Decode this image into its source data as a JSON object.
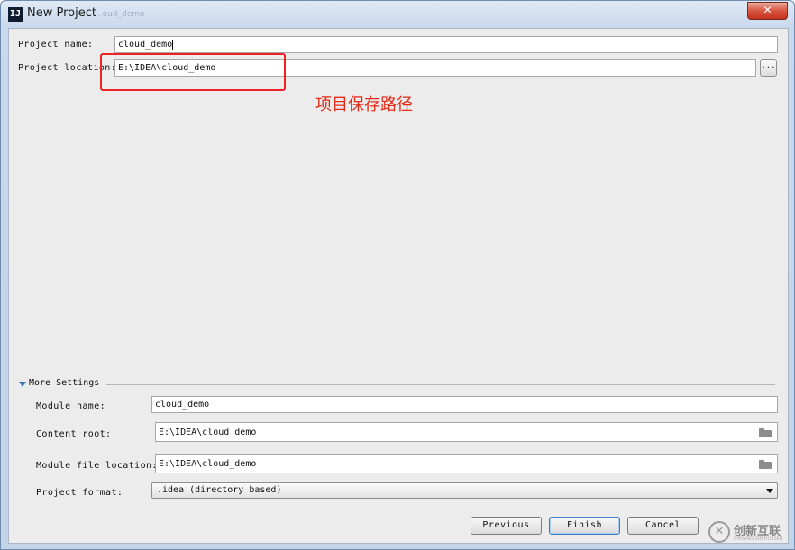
{
  "window": {
    "title": "New Project",
    "ghost_text": "...oud_demo",
    "app_icon_text": "IJ",
    "close_glyph": "✕"
  },
  "project": {
    "name_label": "Project name:",
    "name_value": "cloud_demo",
    "location_label": "Project location:",
    "location_value": "E:\\IDEA\\cloud_demo",
    "browse_label": "..."
  },
  "annotation": {
    "text": "项目保存路径",
    "color": "#e62a18"
  },
  "more_settings": {
    "label": "More Settings",
    "module_name_label": "Module name:",
    "module_name_value": "cloud_demo",
    "content_root_label": "Content root:",
    "content_root_value": "E:\\IDEA\\cloud_demo",
    "module_file_label": "Module file location:",
    "module_file_value": "E:\\IDEA\\cloud_demo",
    "format_label": "Project format:",
    "format_value": ".idea (directory based)"
  },
  "buttons": {
    "previous": "Previous",
    "finish": "Finish",
    "cancel": "Cancel"
  },
  "watermark": {
    "glyph": "✕",
    "text": "创新互联",
    "sub": "CHUANG XIN HU LIAN"
  },
  "icons": [
    "app-icon",
    "close-icon",
    "folder-icon",
    "chevron-down-icon",
    "expand-triangle-icon"
  ]
}
